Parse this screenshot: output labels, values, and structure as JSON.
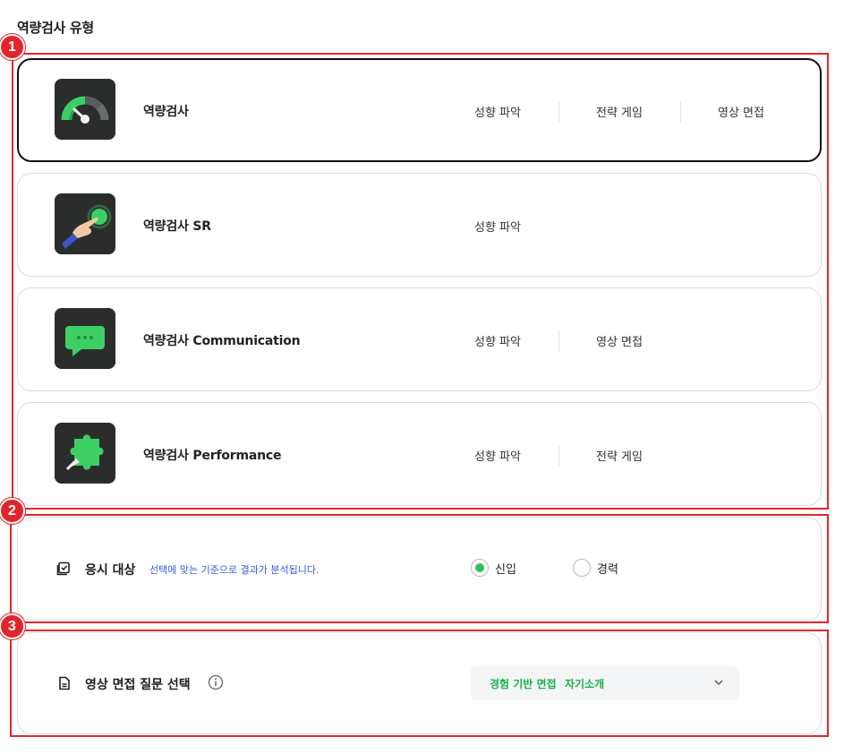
{
  "section_title": "역량검사 유형",
  "annotations": [
    "1",
    "2",
    "3"
  ],
  "test_types": [
    {
      "name": "역량검사",
      "icon": "speedometer-icon",
      "selected": true,
      "tags": [
        "성향 파악",
        "전략 게임",
        "영상 면접"
      ]
    },
    {
      "name": "역량검사 SR",
      "icon": "pointing-hand-icon",
      "selected": false,
      "tags": [
        "성향 파악"
      ]
    },
    {
      "name": "역량검사 Communication",
      "icon": "chat-bubble-icon",
      "selected": false,
      "tags": [
        "성향 파악",
        "영상 면접"
      ]
    },
    {
      "name": "역량검사 Performance",
      "icon": "puzzle-piece-icon",
      "selected": false,
      "tags": [
        "성향 파악",
        "전략 게임"
      ]
    }
  ],
  "target": {
    "title": "응시 대상",
    "hint": "선택에 맞는 기준으로 결과가 분석됩니다.",
    "options": [
      {
        "label": "신입",
        "checked": true
      },
      {
        "label": "경력",
        "checked": false
      }
    ]
  },
  "interview": {
    "title": "영상 면접 질문 선택",
    "selected_chips": [
      "경험 기반 면접",
      "자기소개"
    ]
  },
  "colors": {
    "accent_green": "#2fc15a",
    "annotation_red": "#e5262a",
    "hint_blue": "#3a5bd9"
  }
}
